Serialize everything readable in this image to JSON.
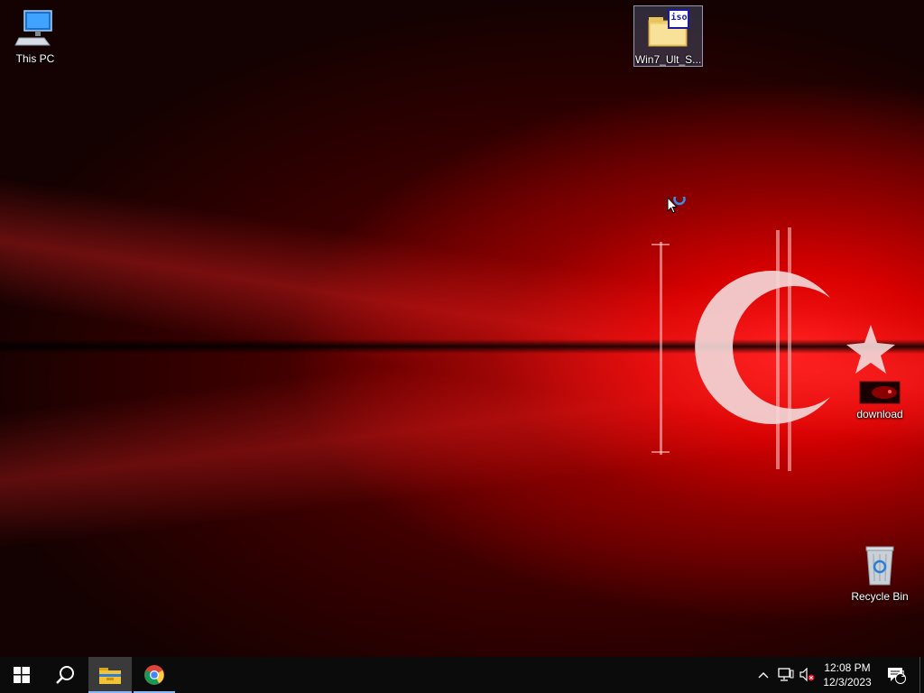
{
  "desktop": {
    "icons": {
      "this_pc": "This PC",
      "iso_file": "Win7_Ult_S...",
      "iso_badge": "iso",
      "download": "download",
      "recycle_bin": "Recycle Bin"
    }
  },
  "taskbar": {
    "apps": [
      "start-windows-icon",
      "search-icon",
      "file-explorer-icon",
      "chrome-icon"
    ],
    "tray": {
      "time": "12:08 PM",
      "date": "12/3/2023",
      "notification_count": "1"
    }
  },
  "colors": {
    "wallpaper_red": "#d80000",
    "taskbar": "#0b0b0b",
    "active_underline": "#8ab4f8"
  }
}
